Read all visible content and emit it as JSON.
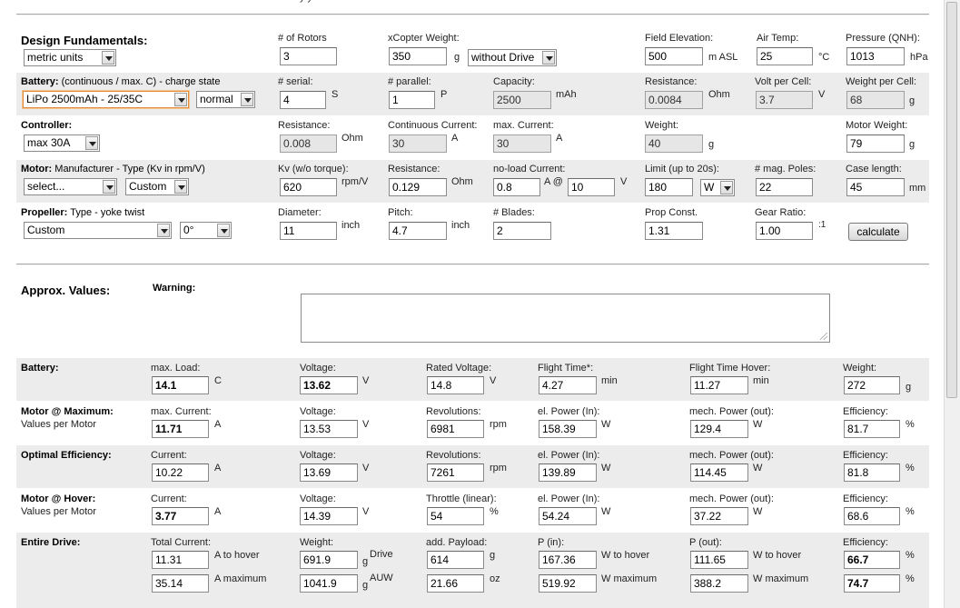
{
  "top_text": "y                    y",
  "design": {
    "title": "Design Fundamentals:",
    "units": "metric units",
    "rotors_label": "# of Rotors",
    "rotors": "3",
    "weight_label": "xCopter Weight:",
    "weight": "350",
    "weight_unit": "g",
    "drive_mode": "without Drive",
    "elev_label": "Field Elevation:",
    "elev": "500",
    "elev_unit": "m ASL",
    "temp_label": "Air Temp:",
    "temp": "25",
    "temp_unit": "°C",
    "pressure_label": "Pressure (QNH):",
    "pressure": "1013",
    "pressure_unit": "hPa"
  },
  "battery_in": {
    "title": "Battery:",
    "sub": " (continuous / max. C) - charge state",
    "type": "LiPo 2500mAh - 25/35C",
    "state": "normal",
    "serial_label": "# serial:",
    "serial": "4",
    "serial_unit": "S",
    "parallel_label": "# parallel:",
    "parallel": "1",
    "parallel_unit": "P",
    "capacity_label": "Capacity:",
    "capacity": "2500",
    "capacity_unit": "mAh",
    "resistance_label": "Resistance:",
    "resistance": "0.0084",
    "resistance_unit": "Ohm",
    "vcell_label": "Volt per Cell:",
    "vcell": "3.7",
    "vcell_unit": "V",
    "wcell_label": "Weight per Cell:",
    "wcell": "68",
    "wcell_unit": "g"
  },
  "controller": {
    "title": "Controller:",
    "type": "max 30A",
    "resistance_label": "Resistance:",
    "resistance": "0.008",
    "resistance_unit": "Ohm",
    "cont_label": "Continuous Current:",
    "cont": "30",
    "cont_unit": "A",
    "max_label": "max. Current:",
    "max": "30",
    "max_unit": "A",
    "weight_label": "Weight:",
    "weight": "40",
    "weight_unit": "g",
    "motor_weight_label": "Motor Weight:",
    "motor_weight": "79",
    "motor_weight_unit": "g"
  },
  "motor_in": {
    "title": "Motor:",
    "sub": " Manufacturer - Type (Kv in rpm/V)",
    "manufacturer": "select...",
    "type": "Custom",
    "kv_label": "Kv (w/o torque):",
    "kv": "620",
    "kv_unit": "rpm/V",
    "resistance_label": "Resistance:",
    "resistance": "0.129",
    "resistance_unit": "Ohm",
    "noload_label": "no-load Current:",
    "noload": "0.8",
    "noload_unit": "A @",
    "noload_v": "10",
    "noload_v_unit": "V",
    "limit_label": "Limit (up to 20s):",
    "limit": "180",
    "limit_unit": "W",
    "poles_label": "# mag. Poles:",
    "poles": "22",
    "case_label": "Case length:",
    "case": "45",
    "case_unit": "mm"
  },
  "propeller": {
    "title": "Propeller:",
    "sub": " Type - yoke twist",
    "type": "Custom",
    "twist": "0°",
    "diameter_label": "Diameter:",
    "diameter": "11",
    "diameter_unit": "inch",
    "pitch_label": "Pitch:",
    "pitch": "4.7",
    "pitch_unit": "inch",
    "blades_label": "# Blades:",
    "blades": "2",
    "const_label": "Prop Const.",
    "const": "1.31",
    "gear_label": "Gear Ratio:",
    "gear": "1.00",
    "gear_unit": ":1",
    "calculate": "calculate"
  },
  "approx": {
    "title": "Approx. Values:",
    "warning_label": "Warning:"
  },
  "battery_out": {
    "title": "Battery:",
    "load_label": "max. Load:",
    "load": "14.1",
    "load_unit": "C",
    "voltage_label": "Voltage:",
    "voltage": "13.62",
    "voltage_unit": "V",
    "rated_label": "Rated Voltage:",
    "rated": "14.8",
    "rated_unit": "V",
    "flight_label": "Flight Time*:",
    "flight": "4.27",
    "flight_unit": "min",
    "hover_label": "Flight Time Hover:",
    "hover": "11.27",
    "hover_unit": "min",
    "weight_label": "Weight:",
    "weight": "272",
    "weight_unit": "g"
  },
  "motor_max": {
    "title": "Motor @ Maximum:",
    "sub": "Values per Motor",
    "current_label": "max. Current:",
    "current": "11.71",
    "current_unit": "A",
    "voltage_label": "Voltage:",
    "voltage": "13.53",
    "voltage_unit": "V",
    "rev_label": "Revolutions:",
    "rev": "6981",
    "rev_unit": "rpm",
    "pin_label": "el. Power (In):",
    "pin": "158.39",
    "pin_unit": "W",
    "pout_label": "mech. Power (out):",
    "pout": "129.4",
    "pout_unit": "W",
    "eff_label": "Efficiency:",
    "eff": "81.7",
    "eff_unit": "%"
  },
  "optimal": {
    "title": "Optimal Efficiency:",
    "current_label": "Current:",
    "current": "10.22",
    "current_unit": "A",
    "voltage_label": "Voltage:",
    "voltage": "13.69",
    "voltage_unit": "V",
    "rev_label": "Revolutions:",
    "rev": "7261",
    "rev_unit": "rpm",
    "pin_label": "el. Power (In):",
    "pin": "139.89",
    "pin_unit": "W",
    "pout_label": "mech. Power (out):",
    "pout": "114.45",
    "pout_unit": "W",
    "eff_label": "Efficiency:",
    "eff": "81.8",
    "eff_unit": "%"
  },
  "hover": {
    "title": "Motor @ Hover:",
    "sub": "Values per Motor",
    "current_label": "Current:",
    "current": "3.77",
    "current_unit": "A",
    "voltage_label": "Voltage:",
    "voltage": "14.39",
    "voltage_unit": "V",
    "throttle_label": "Throttle (linear):",
    "throttle": "54",
    "throttle_unit": "%",
    "pin_label": "el. Power (In):",
    "pin": "54.24",
    "pin_unit": "W",
    "pout_label": "mech. Power (out):",
    "pout": "37.22",
    "pout_unit": "W",
    "eff_label": "Efficiency:",
    "eff": "68.6",
    "eff_unit": "%"
  },
  "drive": {
    "title": "Entire Drive:",
    "total_label": "Total Current:",
    "total_hover": "11.31",
    "total_hover_unit": "A to hover",
    "total_max": "35.14",
    "total_max_unit": "A maximum",
    "weight_label": "Weight:",
    "weight": "691.9",
    "weight_unit_a": "g",
    "weight_unit_b": "Drive",
    "auw": "1041.9",
    "auw_unit_a": "g",
    "auw_unit_b": "AUW",
    "payload_label": "add. Payload:",
    "payload_g": "614",
    "payload_g_unit": "g",
    "payload_oz": "21.66",
    "payload_oz_unit": "oz",
    "pin_label": "P (in):",
    "pin_hover": "167.36",
    "pin_hover_unit": "W to hover",
    "pin_max": "519.92",
    "pin_max_unit": "W maximum",
    "pout_label": "P (out):",
    "pout_hover": "111.65",
    "pout_hover_unit": "W to hover",
    "pout_max": "388.2",
    "pout_max_unit": "W maximum",
    "eff_label": "Efficiency:",
    "eff_hover": "66.7",
    "eff_max": "74.7",
    "eff_unit": "%"
  }
}
